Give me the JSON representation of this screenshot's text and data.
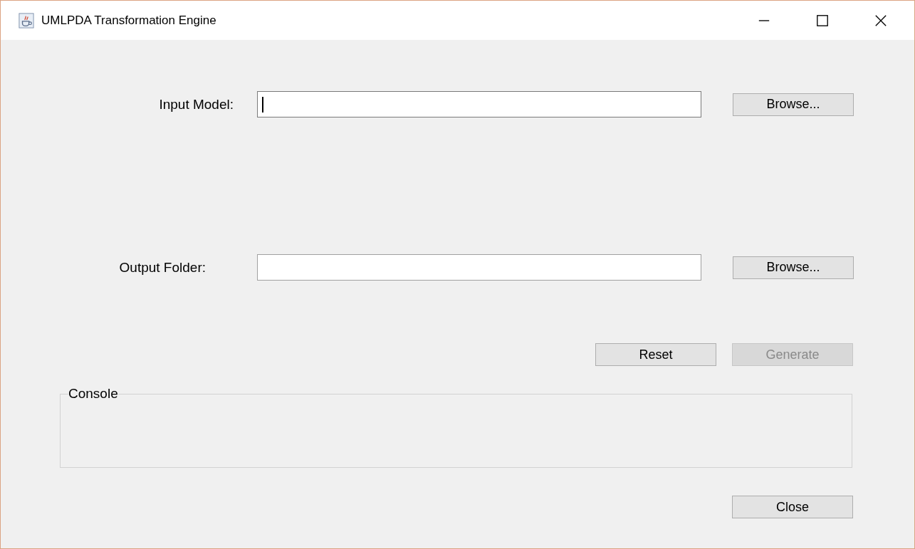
{
  "window": {
    "title": "UMLPDA Transformation Engine"
  },
  "fields": [
    {
      "label": "Input Model:",
      "focused": true,
      "button": "Browse..."
    },
    {
      "label": "Output Folder:",
      "focused": false,
      "button": "Browse..."
    }
  ],
  "actions": [
    {
      "label": "Reset",
      "disabled": false
    },
    {
      "label": "Generate",
      "disabled": true
    }
  ],
  "console": {
    "title": "Console"
  },
  "footer_buttons": [
    {
      "label": "Close",
      "disabled": false
    }
  ]
}
